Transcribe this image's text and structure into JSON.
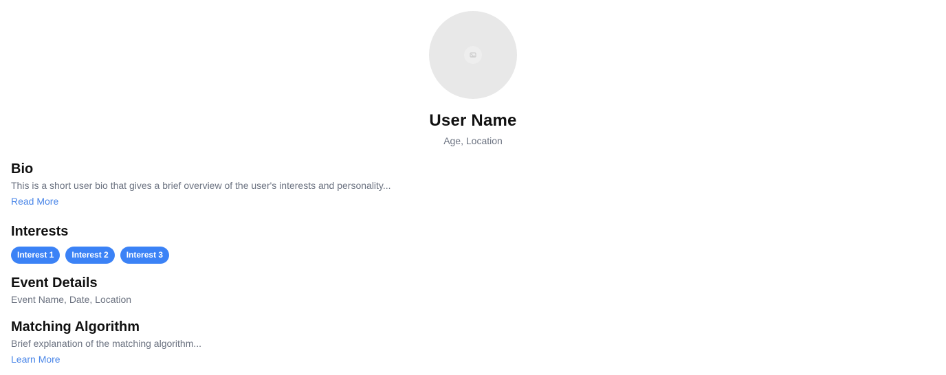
{
  "profile": {
    "avatar_icon": "image-placeholder-icon",
    "name": "User Name",
    "meta": "Age, Location"
  },
  "bio": {
    "title": "Bio",
    "text": "This is a short user bio that gives a brief overview of the user's interests and personality...",
    "link": "Read More"
  },
  "interests": {
    "title": "Interests",
    "items": [
      "Interest 1",
      "Interest 2",
      "Interest 3"
    ]
  },
  "event": {
    "title": "Event Details",
    "text": "Event Name, Date, Location"
  },
  "matching": {
    "title": "Matching Algorithm",
    "text": "Brief explanation of the matching algorithm...",
    "link": "Learn More"
  },
  "colors": {
    "accent": "#3b82f6",
    "link": "#4a86e8",
    "muted_text": "#6b7280",
    "avatar_bg": "#e8e8e8"
  }
}
